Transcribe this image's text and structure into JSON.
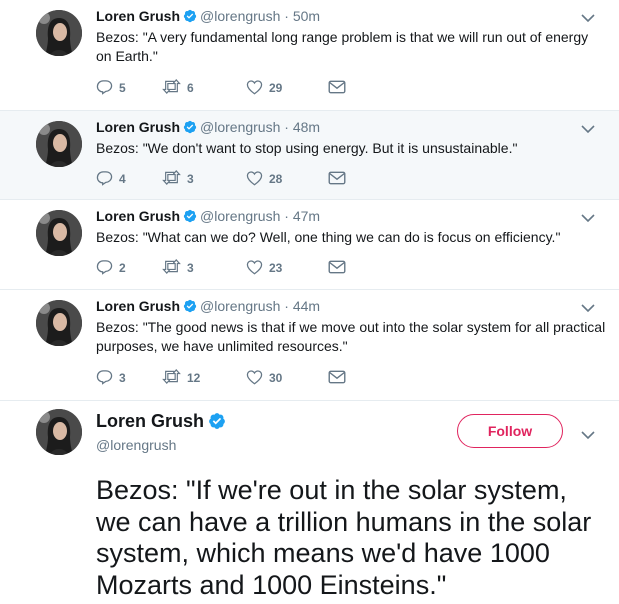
{
  "colors": {
    "thread_line": "#f5a9c3",
    "follow_accent": "#e0245e",
    "verified": "#1da1f2",
    "muted": "#657786"
  },
  "tweets": [
    {
      "name": "Loren Grush",
      "handle": "@lorengrush",
      "dot": "·",
      "time": "50m",
      "text": "Bezos: \"A very fundamental long range problem is that we will run out of energy on Earth.\"",
      "replies": "5",
      "retweets": "6",
      "likes": "29"
    },
    {
      "name": "Loren Grush",
      "handle": "@lorengrush",
      "dot": "·",
      "time": "48m",
      "text": "Bezos: \"We don't want to stop using energy. But it is unsustainable.\"",
      "replies": "4",
      "retweets": "3",
      "likes": "28"
    },
    {
      "name": "Loren Grush",
      "handle": "@lorengrush",
      "dot": "·",
      "time": "47m",
      "text": "Bezos: \"What can we do? Well, one thing we can do is focus on efficiency.\"",
      "replies": "2",
      "retweets": "3",
      "likes": "23"
    },
    {
      "name": "Loren Grush",
      "handle": "@lorengrush",
      "dot": "·",
      "time": "44m",
      "text": "Bezos: \"The good news is that if we move out into the solar system for all practical purposes, we have unlimited resources.\"",
      "replies": "3",
      "retweets": "12",
      "likes": "30"
    }
  ],
  "focused": {
    "name": "Loren Grush",
    "handle": "@lorengrush",
    "follow_label": "Follow",
    "text": "Bezos: \"If we're out in the solar system, we can have a trillion humans in the solar system, which means we'd have 1000 Mozarts and 1000 Einsteins.\""
  },
  "icons": [
    "avatar",
    "verified-badge-icon",
    "chevron-down-icon",
    "reply-icon",
    "retweet-icon",
    "like-icon",
    "direct-message-icon"
  ]
}
